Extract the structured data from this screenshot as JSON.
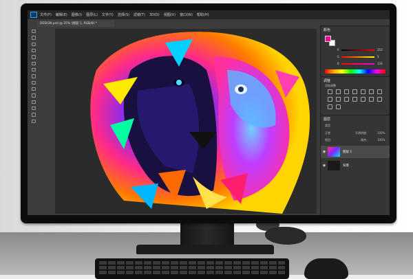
{
  "app": {
    "menu": [
      "文件(F)",
      "编辑(E)",
      "图像(I)",
      "图层(L)",
      "文字(Y)",
      "选择(S)",
      "滤镜(T)",
      "3D(D)",
      "视图(V)",
      "窗口(W)",
      "帮助(H)"
    ],
    "document_tab": "DESIGN.psd @ 25% (图层 1, RGB/8) *"
  },
  "panels": {
    "color": {
      "title": "颜色",
      "foreground_color": "#ea0b8c",
      "sliders": [
        {
          "label": "R",
          "value": "253"
        },
        {
          "label": "G",
          "value": "5"
        },
        {
          "label": "B",
          "value": "133"
        }
      ]
    },
    "adjustments": {
      "title": "调整",
      "subtitle": "添加调整"
    },
    "layers": {
      "title": "图层",
      "kind_label": "类型",
      "blend_mode": "正常",
      "opacity_label": "不透明度:",
      "opacity_value": "100%",
      "lock_label": "锁定:",
      "fill_label": "填充:",
      "fill_value": "100%",
      "items": [
        {
          "name": "图层 1",
          "selected": true
        },
        {
          "name": "背景",
          "selected": false
        }
      ]
    }
  }
}
